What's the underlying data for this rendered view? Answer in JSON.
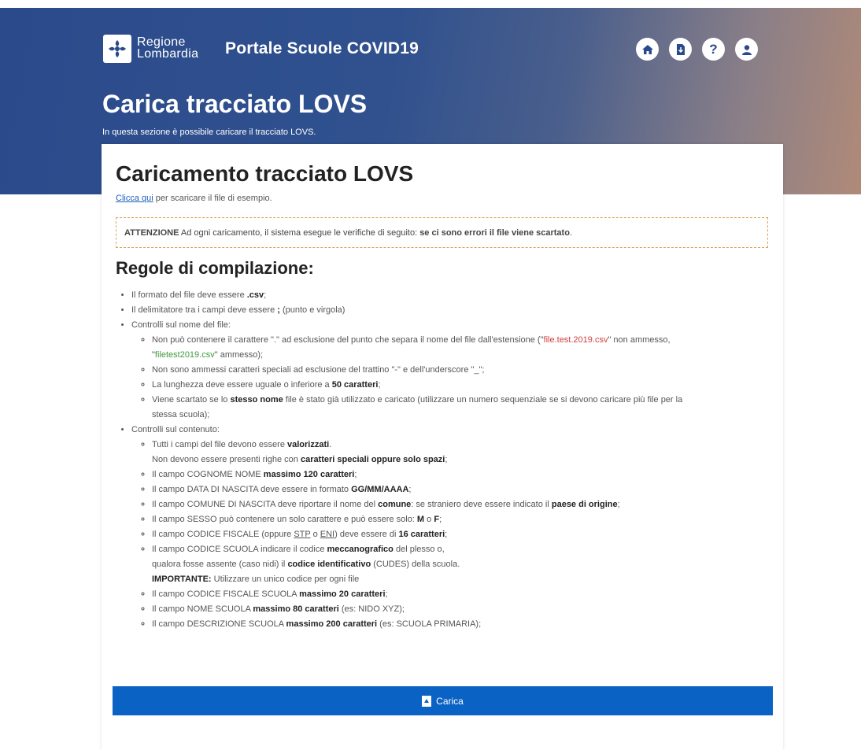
{
  "header": {
    "logo_line1": "Regione",
    "logo_line2": "Lombardia",
    "portal_title": "Portale Scuole COVID19",
    "icons": [
      {
        "name": "home-icon",
        "glyph": "⌂"
      },
      {
        "name": "download-file-icon",
        "glyph": "⤓"
      },
      {
        "name": "help-icon",
        "glyph": "?"
      },
      {
        "name": "user-icon",
        "glyph": "●"
      }
    ]
  },
  "hero": {
    "title": "Carica tracciato LOVS",
    "subtitle": "In questa sezione è possibile caricare il tracciato LOVS."
  },
  "card": {
    "title": "Caricamento tracciato LOVS",
    "link_text": "Clicca qui",
    "link_suffix": " per scaricare il file di esempio.",
    "alert_strong": "ATTENZIONE",
    "alert_text": " Ad ogni caricamento, il sistema esegue le verifiche di seguito: ",
    "alert_bold": "se ci sono errori il file viene scartato",
    "alert_end": ".",
    "rules_title": "Regole di compilazione:"
  },
  "rules": {
    "format_a": "Il formato del file deve essere ",
    "format_b": ".csv",
    "format_c": ";",
    "delim_a": "Il delimitatore tra i campi deve essere ",
    "delim_b": ";",
    "delim_c": " (punto e virgola)",
    "name_header": "Controlli sul nome del file:",
    "name_1a": "Non può contenere il carattere \".\" ad esclusione del punto che separa il nome del file dall'estensione (\"",
    "name_1_red": "file.test.2019.csv",
    "name_1b": "\" non ammesso,",
    "name_1c": "\"",
    "name_1_green": "filetest2019.csv",
    "name_1d": "\" ammesso);",
    "name_2": "Non sono ammessi caratteri speciali ad esclusione del trattino \"-\" e dell'underscore \"_\";",
    "name_3a": "La lunghezza deve essere uguale o inferiore a ",
    "name_3b": "50 caratteri",
    "name_3c": ";",
    "name_4a": "Viene scartato se lo ",
    "name_4b": "stesso nome",
    "name_4c": " file è stato già utilizzato e caricato (utilizzare un numero sequenziale se si devono caricare più file per la",
    "name_4d": "stessa scuola);",
    "content_header": "Controlli sul contenuto:",
    "c1a": "Tutti i campi del file devono essere ",
    "c1b": "valorizzati",
    "c1c": ".",
    "c1d": "Non devono essere presenti righe con ",
    "c1e": "caratteri speciali oppure solo spazi",
    "c1f": ";",
    "c2a": "Il campo COGNOME NOME ",
    "c2b": "massimo 120 caratteri",
    "c2c": ";",
    "c3a": "Il campo DATA DI NASCITA deve essere in formato ",
    "c3b": "GG/MM/AAAA",
    "c3c": ";",
    "c4a": "Il campo COMUNE DI NASCITA deve riportare il nome del ",
    "c4b": "comune",
    "c4c": ": se straniero deve essere indicato il ",
    "c4d": "paese di origine",
    "c4e": ";",
    "c5a": "Il campo SESSO può contenere un solo carattere e può essere solo: ",
    "c5b": "M",
    "c5c": " o ",
    "c5d": "F",
    "c5e": ";",
    "c6a": "Il campo CODICE FISCALE (oppure ",
    "c6b": "STP",
    "c6c": " o ",
    "c6d": "ENI",
    "c6e": ") deve essere di ",
    "c6f": "16 caratteri",
    "c6g": ";",
    "c7a": "Il campo CODICE SCUOLA indicare il codice ",
    "c7b": "meccanografico",
    "c7c": " del plesso o,",
    "c7d": "qualora fosse assente (caso nidi) il ",
    "c7e": "codice identificativo",
    "c7f": " (CUDES) della scuola.",
    "c7g": "IMPORTANTE:",
    "c7h": " Utilizzare un unico codice per ogni file",
    "c8a": "Il campo CODICE FISCALE SCUOLA ",
    "c8b": "massimo 20 caratteri",
    "c8c": ";",
    "c9a": "Il campo NOME SCUOLA ",
    "c9b": "massimo 80 caratteri",
    "c9c": " (es: NIDO XYZ);",
    "c10a": "Il campo DESCRIZIONE SCUOLA ",
    "c10b": "massimo 200 caratteri",
    "c10c": " (es: SCUOLA PRIMARIA);"
  },
  "actions": {
    "upload_label": "Carica"
  },
  "colors": {
    "brand_blue": "#0a62c4",
    "hero_blue": "#2b4a8c",
    "alert_border": "#e0a25b",
    "error_red": "#d04040",
    "ok_green": "#3f9a3f"
  }
}
